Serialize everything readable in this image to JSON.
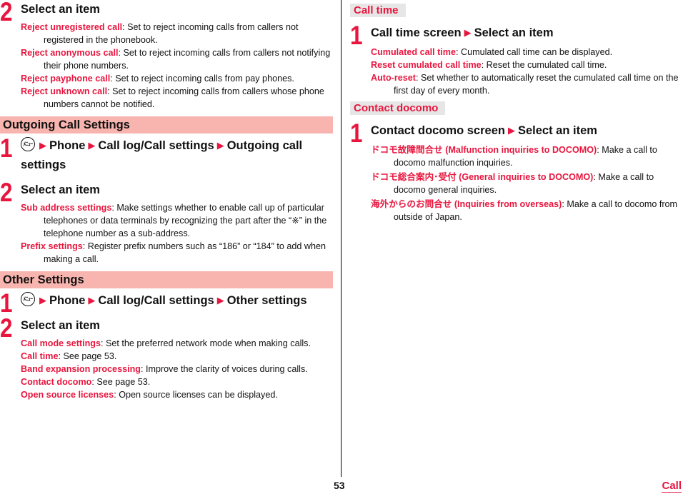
{
  "left": {
    "top_step": {
      "num": "2",
      "title": "Select an item",
      "items": [
        {
          "term": "Reject unregistered call",
          "desc": ": Set to reject incoming calls from callers not registered in the phonebook."
        },
        {
          "term": "Reject anonymous call",
          "desc": ": Set to reject incoming calls from callers not notifying their phone numbers."
        },
        {
          "term": "Reject payphone call",
          "desc": ": Set to reject incoming calls from pay phones."
        },
        {
          "term": "Reject unknown call",
          "desc": ": Set to reject incoming calls from callers whose phone numbers cannot be notified."
        }
      ]
    },
    "outgoing": {
      "heading": "Outgoing Call Settings",
      "step1": {
        "num": "1",
        "menu_icon": "menu-key-icon",
        "menu_glyph": "ﾒﾆｭｰ",
        "path": [
          "Phone",
          "Call log/Call settings",
          "Outgoing call settings"
        ]
      },
      "step2": {
        "num": "2",
        "title": "Select an item",
        "items": [
          {
            "term": "Sub address settings",
            "desc": ": Make settings whether to enable call up of particular telephones or data terminals by recognizing the part after the “※” in the telephone number as a sub-address."
          },
          {
            "term": "Prefix settings",
            "desc": ": Register prefix numbers such as “186” or “184” to add when making a call."
          }
        ]
      }
    },
    "other": {
      "heading": "Other Settings",
      "step1": {
        "num": "1",
        "menu_icon": "menu-key-icon",
        "menu_glyph": "ﾒﾆｭｰ",
        "path": [
          "Phone",
          "Call log/Call settings",
          "Other settings"
        ]
      },
      "step2": {
        "num": "2",
        "title": "Select an item",
        "items": [
          {
            "term": "Call mode settings",
            "desc": ": Set the preferred network mode when making calls."
          },
          {
            "term": "Call time",
            "desc": ": See page 53."
          },
          {
            "term": "Band expansion processing",
            "desc": ": Improve the clarity of voices during calls."
          },
          {
            "term": "Contact docomo",
            "desc": ": See page 53."
          },
          {
            "term": "Open source licenses",
            "desc": ": Open source licenses can be displayed."
          }
        ]
      }
    }
  },
  "right": {
    "call_time": {
      "heading": "Call time",
      "step1": {
        "num": "1",
        "path": [
          "Call time screen",
          "Select an item"
        ],
        "items": [
          {
            "term": "Cumulated call time",
            "desc": ": Cumulated call time can be displayed."
          },
          {
            "term": "Reset cumulated call time",
            "desc": ": Reset the cumulated call time."
          },
          {
            "term": "Auto-reset",
            "desc": ": Set whether to automatically reset the cumulated call time on the first day of every month."
          }
        ]
      }
    },
    "contact": {
      "heading": "Contact docomo",
      "step1": {
        "num": "1",
        "path": [
          "Contact docomo screen",
          "Select an item"
        ],
        "items": [
          {
            "term": "ドコモ故障問合せ (Malfunction inquiries to DOCOMO)",
            "desc": ": Make a call to docomo malfunction inquiries."
          },
          {
            "term": "ドコモ総合案内･受付 (General inquiries to DOCOMO)",
            "desc": ": Make a call to docomo general inquiries."
          },
          {
            "term": "海外からのお問合せ (Inquiries from overseas)",
            "desc": ": Make a call to docomo from outside of Japan."
          }
        ]
      }
    }
  },
  "footer": {
    "page_number": "53",
    "chapter": "Call"
  },
  "colors": {
    "accent_red": "#e8163e",
    "section_band": "#f8b4ae",
    "sub_band": "#e6e6e6"
  }
}
